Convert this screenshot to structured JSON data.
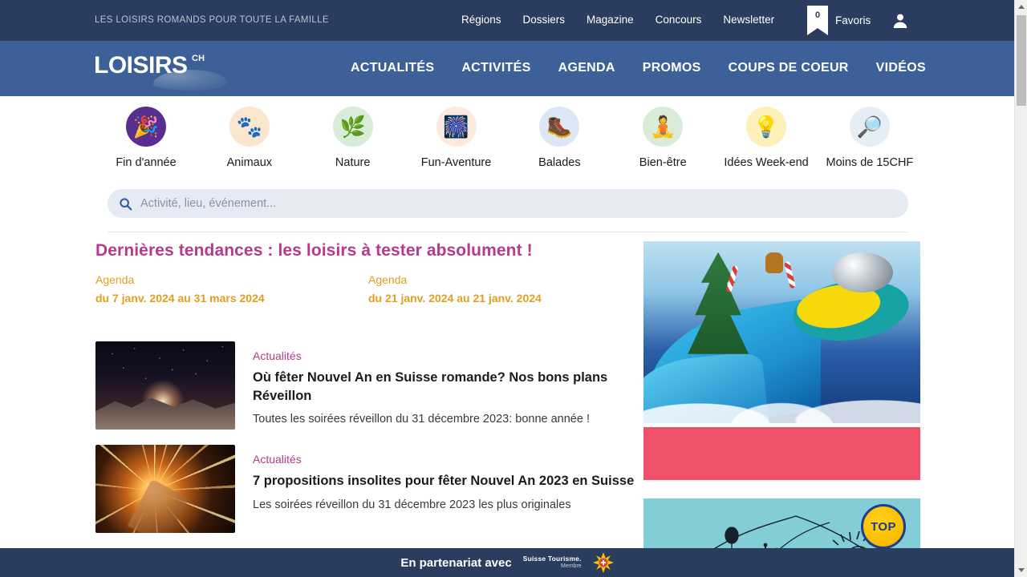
{
  "topbar": {
    "tagline": "LES LOISIRS ROMANDS POUR TOUTE LA FAMILLE",
    "links": [
      {
        "label": "Régions"
      },
      {
        "label": "Dossiers"
      },
      {
        "label": "Magazine"
      },
      {
        "label": "Concours"
      },
      {
        "label": "Newsletter"
      }
    ],
    "favorites": {
      "count": "0",
      "label": "Favoris"
    },
    "account_icon": "user-icon",
    "bg_color": "#2a3d5f"
  },
  "mainnav": {
    "logo": {
      "word": "LOISIRS",
      "sup": "CH",
      "dot": "."
    },
    "links": [
      {
        "label": "ACTUALITÉS"
      },
      {
        "label": "ACTIVITÉS"
      },
      {
        "label": "AGENDA"
      },
      {
        "label": "PROMOS"
      },
      {
        "label": "COUPS DE COEUR"
      },
      {
        "label": "VIDÉOS"
      }
    ],
    "bg_color": "#3c6097"
  },
  "categories": [
    {
      "label": "Fin d'année",
      "icon": "confetti-icon",
      "glyph": "🎉",
      "bubble": "#5a2d91"
    },
    {
      "label": "Animaux",
      "icon": "paw-icon",
      "glyph": "🐾",
      "bubble": "#fae6cd"
    },
    {
      "label": "Nature",
      "icon": "leaf-icon",
      "glyph": "🌿",
      "bubble": "#d9ecd7"
    },
    {
      "label": "Fun-Aventure",
      "icon": "firework-icon",
      "glyph": "🎆",
      "bubble": "#fdeadf"
    },
    {
      "label": "Balades",
      "icon": "boot-icon",
      "glyph": "🥾",
      "bubble": "#dce7f6"
    },
    {
      "label": "Bien-être",
      "icon": "meditation-icon",
      "glyph": "🧘",
      "bubble": "#d8ecd7"
    },
    {
      "label": "Idées Week-end",
      "icon": "bulb-icon",
      "glyph": "💡",
      "bubble": "#fdf0b8"
    },
    {
      "label": "Moins de 15CHF",
      "icon": "discount-icon",
      "glyph": "🔎",
      "bubble": "#e6eef5"
    }
  ],
  "search": {
    "placeholder": "Activité, lieu, événement...",
    "value": "",
    "icon": "search-icon"
  },
  "main": {
    "headline": "Dernières tendances : les loisirs à tester absolument !",
    "agenda": [
      {
        "kicker": "Agenda",
        "dates": "du 7 janv. 2024  au 31 mars 2024"
      },
      {
        "kicker": "Agenda",
        "dates": "du 21 janv. 2024  au 21 janv. 2024"
      }
    ],
    "articles": [
      {
        "kicker": "Actualités",
        "title": "Où fêter Nouvel An en Suisse romande? Nos bons plans Réveillon",
        "lede": "Toutes les soirées réveillon du 31 décembre 2023: bonne année !",
        "thumb": "night-mountain-photo"
      },
      {
        "kicker": "Actualités",
        "title": "7 propositions insolites pour fêter Nouvel An 2023 en Suisse",
        "lede": "Les soirées réveillon du 31 décembre 2023 les plus originales",
        "thumb": "champagne-sparkler-photo"
      }
    ]
  },
  "rail": {
    "ad_waterpark": "waterpark-christmas-ad",
    "ad_pink": "pink-banner-ad",
    "ad_top": {
      "badge": "TOP",
      "name": "mountain-landscape-ad",
      "bg": "#82cdd6"
    }
  },
  "footer": {
    "text": "En partenariat avec",
    "partner_name": "Suisse Tourisme.",
    "partner_sub": "Membre",
    "logo_icon": "edelweiss-sun-icon"
  },
  "scrollbar": {
    "up_icon": "caret-up-icon",
    "down_icon": "caret-down-icon"
  }
}
